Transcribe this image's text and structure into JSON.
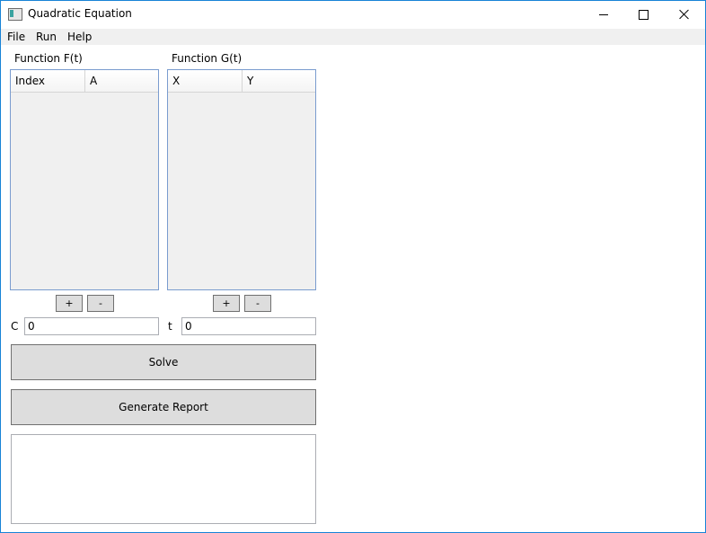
{
  "window": {
    "title": "Quadratic Equation"
  },
  "menu": {
    "items": [
      {
        "label": "File"
      },
      {
        "label": "Run"
      },
      {
        "label": "Help"
      }
    ]
  },
  "function_f": {
    "label": "Function F(t)",
    "columns": [
      "Index",
      "A"
    ],
    "rows": [],
    "add_label": "+",
    "remove_label": "-"
  },
  "function_g": {
    "label": "Function G(t)",
    "columns": [
      "X",
      "Y"
    ],
    "rows": [],
    "add_label": "+",
    "remove_label": "-"
  },
  "inputs": {
    "c_label": "C",
    "c_value": "0",
    "t_label": "t",
    "t_value": "0"
  },
  "actions": {
    "solve_label": "Solve",
    "report_label": "Generate Report"
  },
  "output": {
    "text": ""
  },
  "colors": {
    "window_border": "#1883d7",
    "list_border": "#7a9ccf",
    "button_bg": "#dddddd",
    "menubar_bg": "#f0f0f0"
  }
}
